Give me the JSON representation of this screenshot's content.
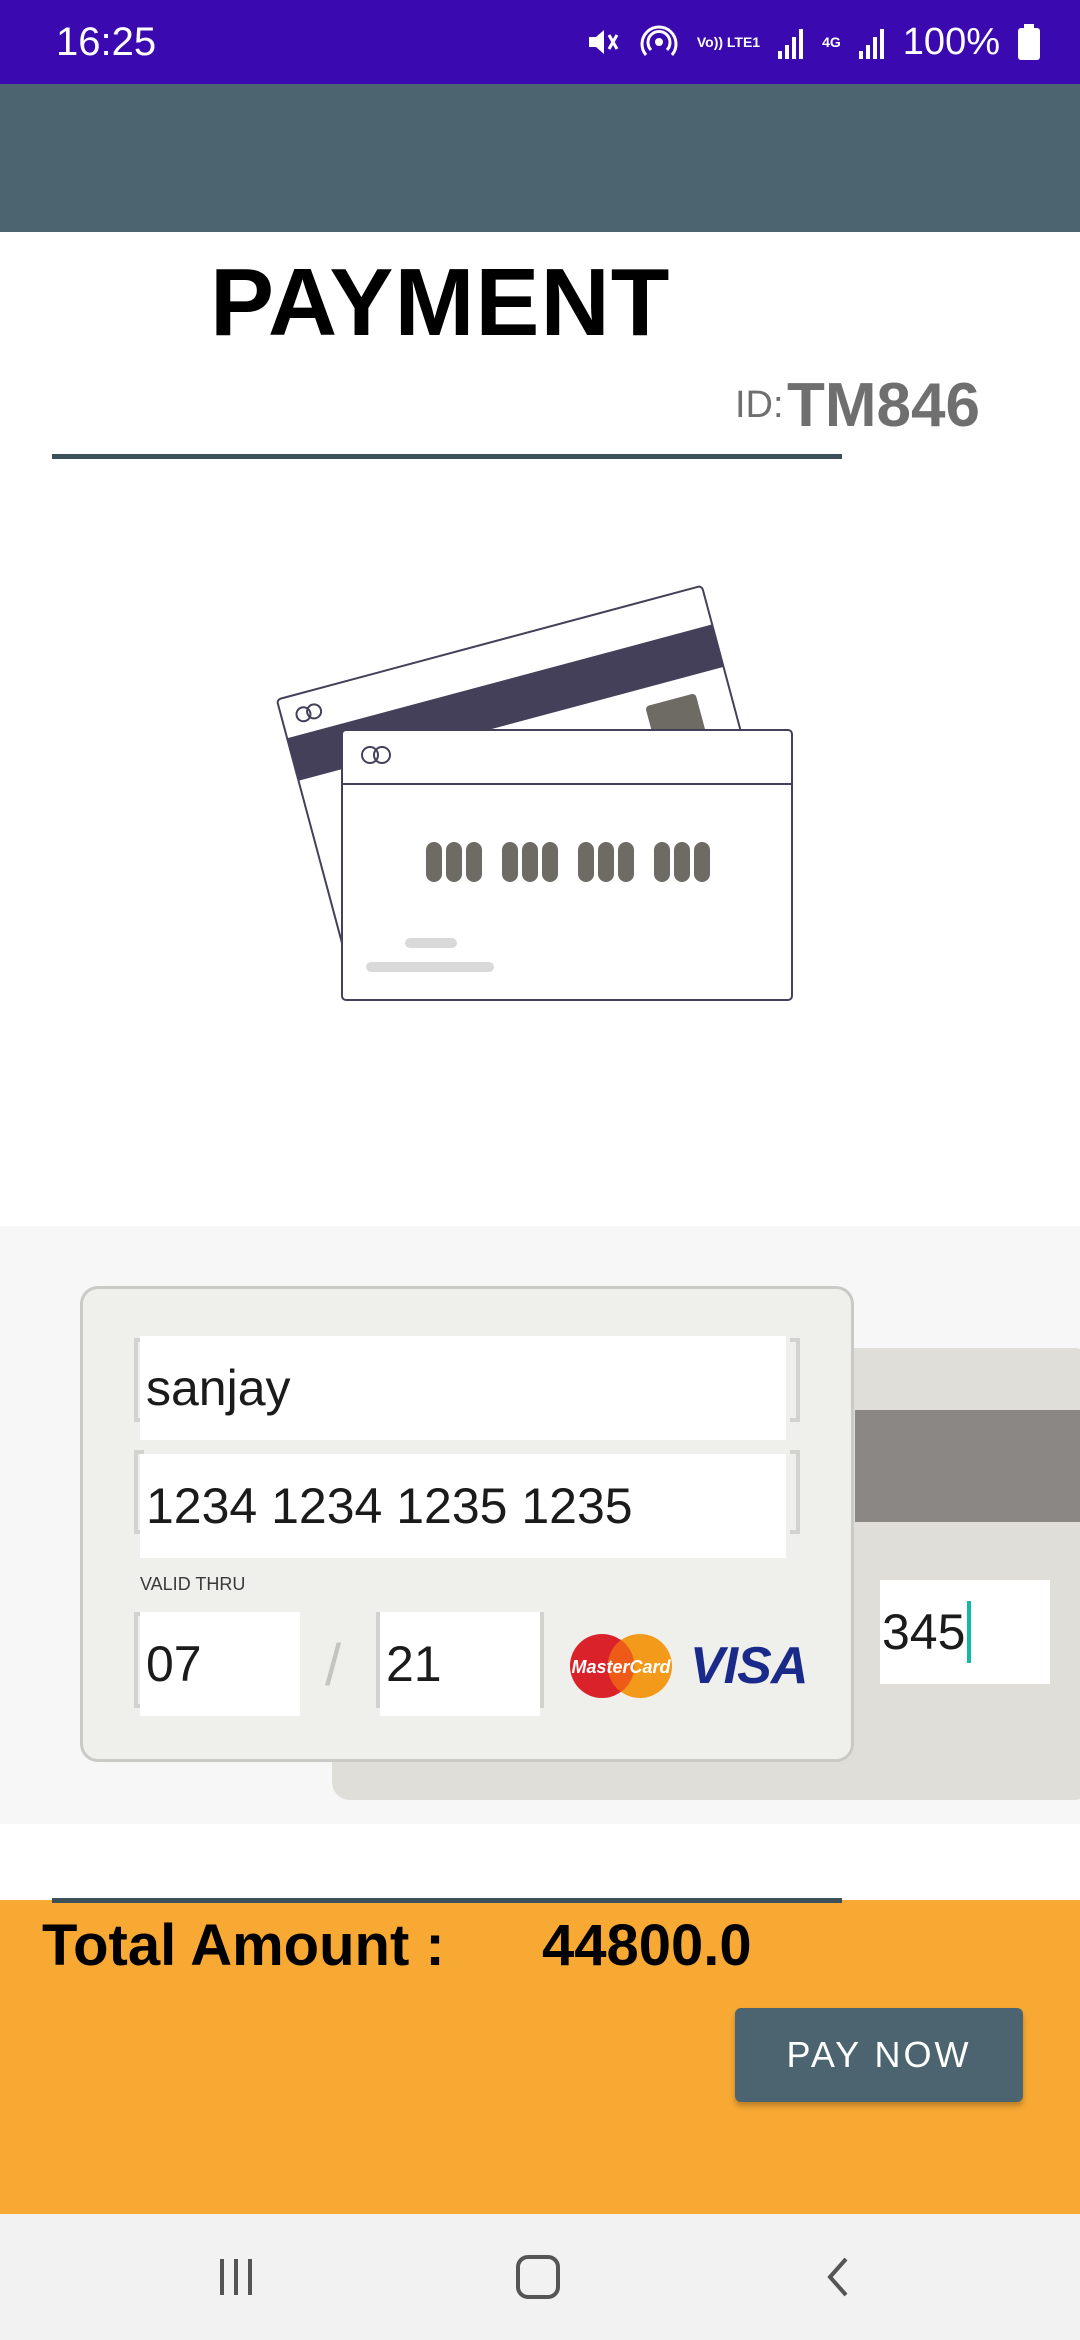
{
  "status_bar": {
    "time": "16:25",
    "battery": "100%",
    "network_label": "4G",
    "volte_label": "Vo)) LTE1",
    "icons": [
      "mute-icon",
      "hotspot-icon",
      "volte-icon",
      "signal-icon",
      "4g-signal-icon",
      "battery-icon"
    ]
  },
  "header": {
    "title": "PAYMENT",
    "id_label": "ID:",
    "id_value": "TM846"
  },
  "illustration": {
    "icon": "credit-cards-illustration",
    "colors": {
      "stripe": "#45405a",
      "chip": "#6e6a64",
      "digits": "#6e6a64",
      "outline": "#45405a"
    }
  },
  "card_form": {
    "name_value": "sanjay",
    "card_number_value": "1234 1234 1235 1235",
    "valid_thru_label": "VALID THRU",
    "month_value": "07",
    "separator": "/",
    "year_value": "21",
    "cvv_value": "345",
    "brand_logos": [
      "mastercard-logo",
      "visa-logo"
    ],
    "mastercard_text": "MasterCard",
    "visa_text": "VISA"
  },
  "total": {
    "label": "Total Amount :",
    "value": "44800.0"
  },
  "actions": {
    "pay_label": "PAY NOW"
  },
  "colors": {
    "status_bar": "#3a0ab0",
    "app_bar": "#4b6470",
    "bottom_panel": "#f8a934",
    "pay_button": "#4b6470"
  },
  "nav_bar": {
    "icons": [
      "recent-apps-icon",
      "home-icon",
      "back-icon"
    ]
  }
}
